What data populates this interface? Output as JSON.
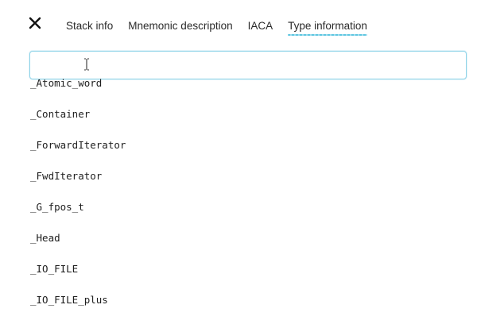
{
  "header": {
    "close_icon": "close-icon",
    "tabs": [
      {
        "label": "Stack info",
        "active": false
      },
      {
        "label": "Mnemonic description",
        "active": false
      },
      {
        "label": "IACA",
        "active": false
      },
      {
        "label": "Type information",
        "active": true
      }
    ],
    "active_tab_underline_color": "#5ec6e0"
  },
  "search": {
    "value": "",
    "placeholder": "",
    "border_color": "#8fd3e8",
    "cursor_icon": "text-cursor-icon"
  },
  "types": {
    "items": [
      "_Atomic_word",
      "_Container",
      "_ForwardIterator",
      "_FwdIterator",
      "_G_fpos_t",
      "_Head",
      "_IO_FILE",
      "_IO_FILE_plus"
    ]
  }
}
